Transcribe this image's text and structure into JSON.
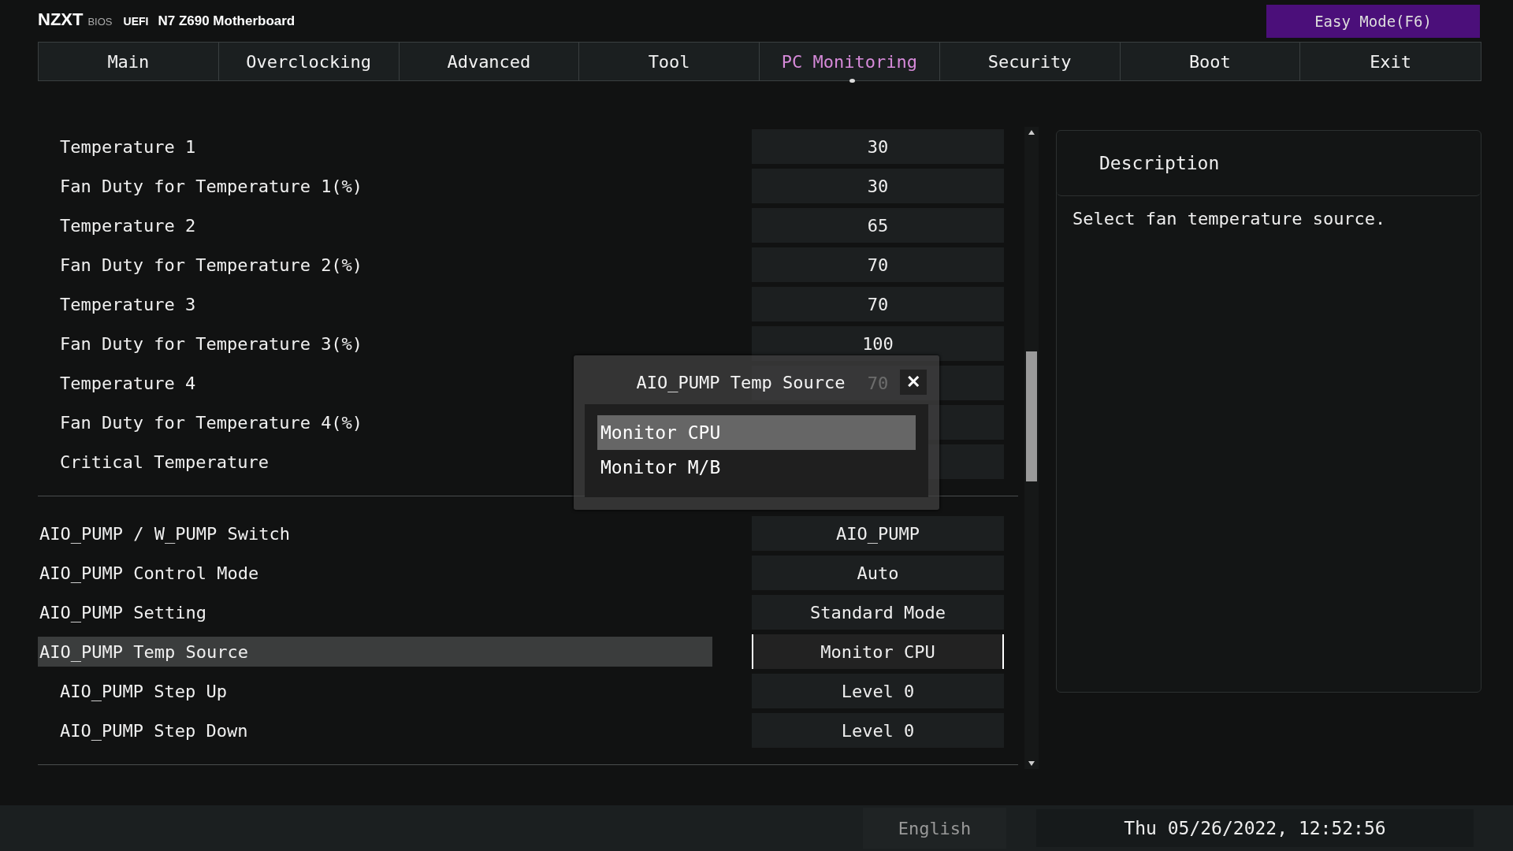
{
  "header": {
    "brand": "NZXT",
    "bios": "BIOS",
    "uefi": "UEFI",
    "model": "N7 Z690 Motherboard",
    "easy_mode": "Easy Mode(F6)"
  },
  "tabs": [
    {
      "label": "Main",
      "selected": false
    },
    {
      "label": "Overclocking",
      "selected": false
    },
    {
      "label": "Advanced",
      "selected": false
    },
    {
      "label": "Tool",
      "selected": false
    },
    {
      "label": "PC Monitoring",
      "selected": true
    },
    {
      "label": "Security",
      "selected": false
    },
    {
      "label": "Boot",
      "selected": false
    },
    {
      "label": "Exit",
      "selected": false
    }
  ],
  "sections": [
    {
      "children": [
        {
          "label": "Temperature 1",
          "value": "30",
          "selected": false
        },
        {
          "label": "Fan Duty for Temperature 1(%)",
          "value": "30",
          "selected": false
        },
        {
          "label": "Temperature 2",
          "value": "65",
          "selected": false
        },
        {
          "label": "Fan Duty for Temperature 2(%)",
          "value": "70",
          "selected": false
        },
        {
          "label": "Temperature 3",
          "value": "70",
          "selected": false
        },
        {
          "label": "Fan Duty for Temperature 3(%)",
          "value": "100",
          "selected": false
        },
        {
          "label": "Temperature 4",
          "value": "70",
          "selected": false
        },
        {
          "label": "Fan Duty for Temperature 4(%)",
          "selected": false
        },
        {
          "label": "Critical Temperature",
          "selected": false
        }
      ]
    },
    {
      "rows": [
        {
          "label": "AIO_PUMP / W_PUMP Switch",
          "value": "AIO_PUMP",
          "selected": false
        },
        {
          "label": "AIO_PUMP Control Mode",
          "value": "Auto",
          "selected": false
        },
        {
          "label": "AIO_PUMP Setting",
          "value": "Standard Mode",
          "selected": false
        },
        {
          "label": "AIO_PUMP Temp Source",
          "value": "Monitor CPU",
          "selected": true,
          "children": [
            {
              "label": "AIO_PUMP Step Up",
              "value": "Level 0",
              "selected": false
            },
            {
              "label": "AIO_PUMP Step Down",
              "value": "Level 0",
              "selected": false
            }
          ]
        }
      ]
    }
  ],
  "description": {
    "title": "Description",
    "text": "Select fan temperature source."
  },
  "popup": {
    "title": "AIO_PUMP Temp Source",
    "close": "✕",
    "options": [
      {
        "label": "Monitor CPU",
        "selected": true
      },
      {
        "label": "Monitor M/B",
        "selected": false
      }
    ]
  },
  "status_bar": {
    "language": "English",
    "datetime": "Thu 05/26/2022, 12:52:56"
  }
}
